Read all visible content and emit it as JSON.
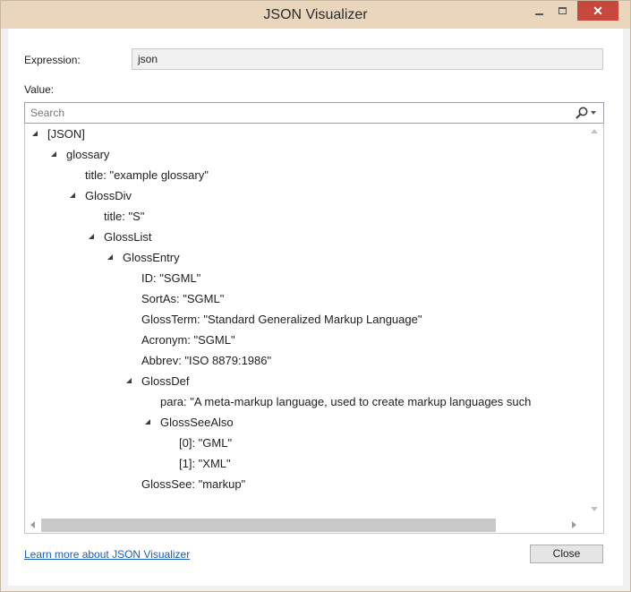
{
  "window": {
    "title": "JSON Visualizer",
    "controls": {
      "minimize_icon": "minimize-icon",
      "maximize_icon": "maximize-icon",
      "close_glyph": "✕"
    },
    "titlebar_color": "#e9d6bd",
    "close_color": "#c7483d"
  },
  "expression": {
    "label": "Expression:",
    "value": "json"
  },
  "value": {
    "label": "Value:"
  },
  "search": {
    "placeholder": "Search",
    "icon": "search-icon",
    "dropdown_icon": "chevron-down-icon"
  },
  "tree": {
    "rows": [
      {
        "text": "[JSON]",
        "expander": true
      },
      {
        "text": "glossary",
        "expander": true
      },
      {
        "text": "title: \"example glossary\"",
        "expander": false
      },
      {
        "text": "GlossDiv",
        "expander": true
      },
      {
        "text": "title: \"S\"",
        "expander": false
      },
      {
        "text": "GlossList",
        "expander": true
      },
      {
        "text": "GlossEntry",
        "expander": true
      },
      {
        "text": "ID: \"SGML\"",
        "expander": false
      },
      {
        "text": "SortAs: \"SGML\"",
        "expander": false
      },
      {
        "text": "GlossTerm: \"Standard Generalized Markup Language\"",
        "expander": false
      },
      {
        "text": "Acronym: \"SGML\"",
        "expander": false
      },
      {
        "text": "Abbrev: \"ISO 8879:1986\"",
        "expander": false
      },
      {
        "text": "GlossDef",
        "expander": true
      },
      {
        "text": "para: \"A meta-markup language, used to create markup languages such",
        "expander": false
      },
      {
        "text": "GlossSeeAlso",
        "expander": true
      },
      {
        "text": "[0]: \"GML\"",
        "expander": false
      },
      {
        "text": "[1]: \"XML\"",
        "expander": false
      },
      {
        "text": "GlossSee: \"markup\"",
        "expander": false
      }
    ]
  },
  "footer": {
    "link_text": "Learn more about JSON Visualizer",
    "close_label": "Close",
    "link_color": "#1a5eb8"
  }
}
